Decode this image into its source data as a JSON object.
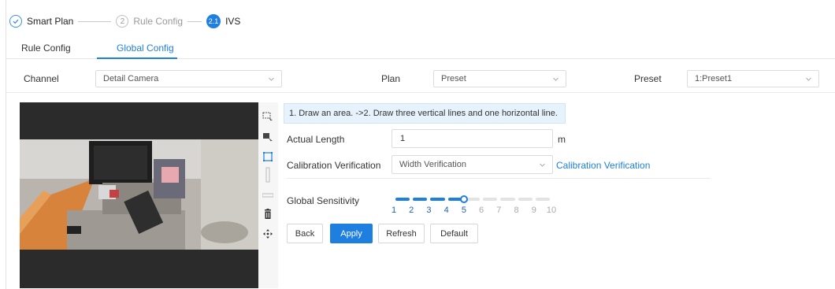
{
  "stepper": {
    "steps": [
      {
        "label": "Smart Plan",
        "state": "done"
      },
      {
        "label": "Rule Config",
        "number": "2",
        "state": "todo"
      },
      {
        "label": "IVS",
        "number": "2.1",
        "state": "active"
      }
    ]
  },
  "tabs": [
    {
      "label": "Rule Config",
      "active": false
    },
    {
      "label": "Global Config",
      "active": true
    }
  ],
  "filters": {
    "channel_label": "Channel",
    "channel_value": "Detail Camera",
    "plan_label": "Plan",
    "plan_value": "Preset",
    "preset_label": "Preset",
    "preset_value": "1:Preset1"
  },
  "tools": [
    "select-area-icon",
    "draw-rule-icon",
    "draw-rectangle-icon",
    "vertical-line-icon",
    "horizontal-line-icon",
    "delete-icon",
    "move-icon"
  ],
  "config": {
    "hint": "1. Draw an area. ->2. Draw three vertical lines and one horizontal line.",
    "actual_length_label": "Actual Length",
    "actual_length_value": "1",
    "actual_length_unit": "m",
    "calibration_label": "Calibration Verification",
    "calibration_value": "Width Verification",
    "calibration_link": "Calibration Verification",
    "sensitivity_label": "Global Sensitivity",
    "sensitivity_value": 5,
    "sensitivity_ticks": [
      "1",
      "2",
      "3",
      "4",
      "5",
      "6",
      "7",
      "8",
      "9",
      "10"
    ]
  },
  "buttons": {
    "back": "Back",
    "apply": "Apply",
    "refresh": "Refresh",
    "default": "Default"
  },
  "colors": {
    "accent": "#1f7fe0",
    "hint_bg": "#e6f2fc"
  }
}
